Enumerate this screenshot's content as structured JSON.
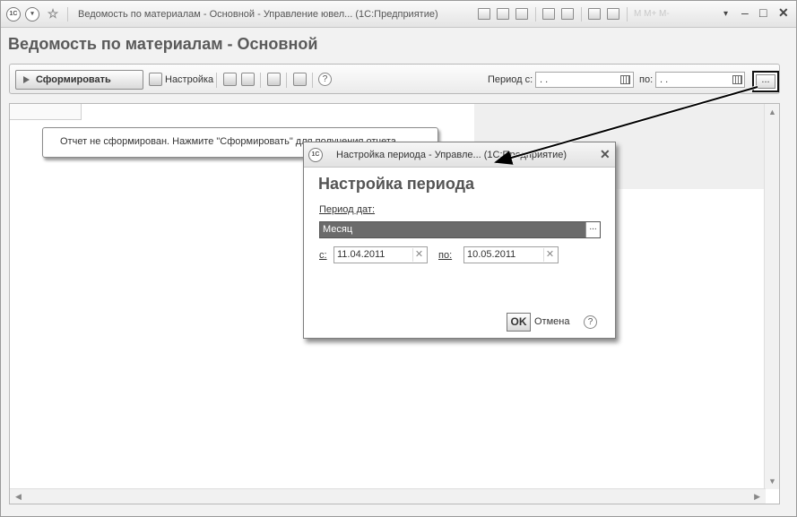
{
  "window": {
    "title": "Ведомость по материалам - Основной - Управление ювел... (1С:Предприятие)",
    "faded_items": "M  M+ M-"
  },
  "page": {
    "title": "Ведомость по материалам - Основной"
  },
  "toolbar": {
    "generate_label": "Сформировать",
    "settings_label": "Настройка",
    "help_symbol": "?",
    "period_from_label": "Период с:",
    "period_from_value": " .  .",
    "period_to_label": "по:",
    "period_to_value": " .  .",
    "more_symbol": "..."
  },
  "report": {
    "notice": "Отчет не сформирован. Нажмите \"Сформировать\" для получения отчета."
  },
  "dialog": {
    "title": "Настройка периода - Управле... (1С:Предприятие)",
    "close_symbol": "✕",
    "heading": "Настройка периода",
    "period_type_label": "Период дат:",
    "period_type_value": "Месяц",
    "from_label": "с:",
    "from_value": "11.04.2011",
    "to_label": "по:",
    "to_value": "10.05.2011",
    "ok_label": "OK",
    "cancel_label": "Отмена",
    "help_symbol": "?"
  },
  "colors": {
    "selected_fill": "#6b6b6b",
    "highlight_border": "#111111",
    "annotation_arrow": "#000000"
  },
  "icons": [
    "app-logo-icon",
    "menu-icon",
    "favorite-icon",
    "save-icon",
    "print-icon",
    "preview-icon",
    "calendar-icon",
    "help-icon",
    "close-icon",
    "clear-icon"
  ]
}
